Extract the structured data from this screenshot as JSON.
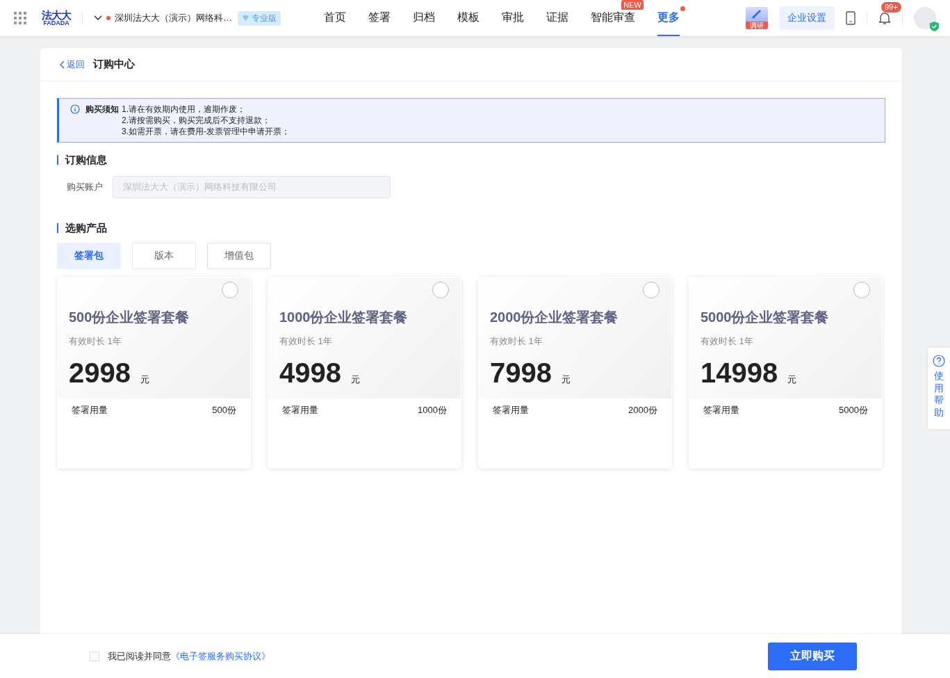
{
  "topbar": {
    "logo": {
      "name": "法大大",
      "sub": "FADADA"
    },
    "company": {
      "name": "深圳法大大（演示）网络科…"
    },
    "edition": "专业版",
    "nav": [
      {
        "label": "首页",
        "selected": false
      },
      {
        "label": "签署",
        "selected": false
      },
      {
        "label": "归档",
        "selected": false
      },
      {
        "label": "模板",
        "selected": false
      },
      {
        "label": "审批",
        "selected": false
      },
      {
        "label": "证据",
        "selected": false
      },
      {
        "label": "智能审查",
        "selected": false,
        "badge": "NEW"
      },
      {
        "label": "更多",
        "selected": true,
        "dot": true
      }
    ],
    "survey_label": "调研",
    "settings_button": "企业设置",
    "notifications": "99+"
  },
  "header": {
    "back": "返回",
    "title": "订购中心"
  },
  "notice": {
    "title": "购买须知",
    "lines": [
      "1.请在有效期内使用，逾期作废；",
      "2.请按需购买，购买完成后不支持退款；",
      "3.如需开票，请在费用-发票管理中申请开票；"
    ]
  },
  "order_info": {
    "heading": "订购信息",
    "account_label": "购买账户",
    "account_value": "深圳法大大（演示）网络科技有限公司",
    "disabled": true
  },
  "products": {
    "heading": "选购产品",
    "tabs": [
      {
        "label": "签署包",
        "selected": true
      },
      {
        "label": "版本",
        "selected": false
      },
      {
        "label": "增值包",
        "selected": false
      }
    ],
    "cards": [
      {
        "title": "500份企业签署套餐",
        "validity": "有效时长 1年",
        "price": "2998",
        "unit": "元",
        "usage_label": "签署用量",
        "usage_value": "500份",
        "selected": false
      },
      {
        "title": "1000份企业签署套餐",
        "validity": "有效时长 1年",
        "price": "4998",
        "unit": "元",
        "usage_label": "签署用量",
        "usage_value": "1000份",
        "selected": false
      },
      {
        "title": "2000份企业签署套餐",
        "validity": "有效时长 1年",
        "price": "7998",
        "unit": "元",
        "usage_label": "签署用量",
        "usage_value": "2000份",
        "selected": false
      },
      {
        "title": "5000份企业签署套餐",
        "validity": "有效时长 1年",
        "price": "14998",
        "unit": "元",
        "usage_label": "签署用量",
        "usage_value": "5000份",
        "selected": false
      }
    ]
  },
  "help_tab": "使用帮助",
  "footer": {
    "agree_checked": false,
    "agree_text": "我已阅读并同意",
    "agreement_link": "《电子签服务购买协议》",
    "buy_button": "立即购买"
  }
}
